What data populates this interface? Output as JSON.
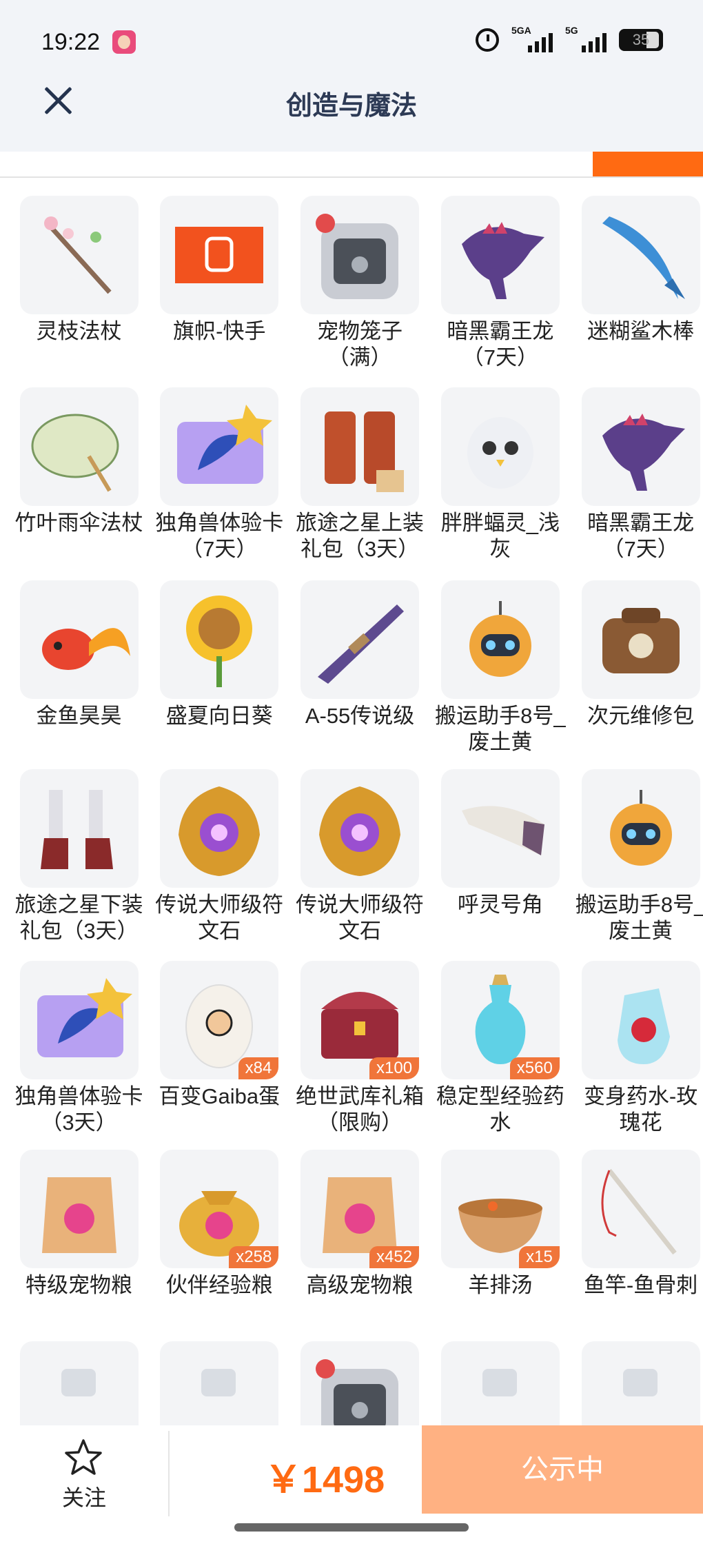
{
  "status_bar": {
    "time": "19:22",
    "signal_1": "5GA",
    "signal_2": "5G",
    "battery": "35"
  },
  "header": {
    "title": "创造与魔法"
  },
  "items": [
    {
      "name": "灵枝法杖",
      "qty": "",
      "icon": "twig-staff-icon"
    },
    {
      "name": "旗帜-快手",
      "qty": "",
      "icon": "kuaishou-flag-icon"
    },
    {
      "name": "宠物笼子（满）",
      "qty": "",
      "icon": "pet-cage-icon"
    },
    {
      "name": "暗黑霸王龙（7天）",
      "qty": "",
      "icon": "dark-trex-icon"
    },
    {
      "name": "迷糊鲨木棒",
      "qty": "",
      "icon": "shark-club-icon"
    },
    {
      "name": "竹叶雨伞法杖",
      "qty": "",
      "icon": "umbrella-staff-icon"
    },
    {
      "name": "独角兽体验卡（7天）",
      "qty": "",
      "icon": "unicorn-card-icon"
    },
    {
      "name": "旅途之星上装礼包（3天）",
      "qty": "",
      "icon": "top-outfit-gift-icon"
    },
    {
      "name": "胖胖蝠灵_浅灰",
      "qty": "",
      "icon": "bat-spirit-icon"
    },
    {
      "name": "暗黑霸王龙（7天）",
      "qty": "",
      "icon": "dark-trex-icon"
    },
    {
      "name": "金鱼昊昊",
      "qty": "",
      "icon": "goldfish-icon"
    },
    {
      "name": "盛夏向日葵",
      "qty": "",
      "icon": "sunflower-icon"
    },
    {
      "name": "A-55传说级",
      "qty": "",
      "icon": "rifle-icon"
    },
    {
      "name": "搬运助手8号_废土黄",
      "qty": "",
      "icon": "helper-robot-icon"
    },
    {
      "name": "次元维修包",
      "qty": "",
      "icon": "repair-bag-icon"
    },
    {
      "name": "旅途之星下装礼包（3天）",
      "qty": "",
      "icon": "boots-gift-icon"
    },
    {
      "name": "传说大师级符文石",
      "qty": "",
      "icon": "rune-stone-icon"
    },
    {
      "name": "传说大师级符文石",
      "qty": "",
      "icon": "rune-stone-icon"
    },
    {
      "name": "呼灵号角",
      "qty": "",
      "icon": "horn-icon"
    },
    {
      "name": "搬运助手8号_废土黄",
      "qty": "",
      "icon": "helper-robot-icon"
    },
    {
      "name": "独角兽体验卡（3天）",
      "qty": "",
      "icon": "unicorn-card-icon"
    },
    {
      "name": "百变Gaiba蛋",
      "qty": "x84",
      "icon": "egg-icon"
    },
    {
      "name": "绝世武库礼箱（限购）",
      "qty": "x100",
      "icon": "treasure-chest-icon"
    },
    {
      "name": "稳定型经验药水",
      "qty": "x560",
      "icon": "potion-icon"
    },
    {
      "name": "变身药水-玫瑰花",
      "qty": "",
      "icon": "rose-potion-icon"
    },
    {
      "name": "特级宠物粮",
      "qty": "",
      "icon": "pet-food-bag-icon"
    },
    {
      "name": "伙伴经验粮",
      "qty": "x258",
      "icon": "exp-food-sack-icon"
    },
    {
      "name": "高级宠物粮",
      "qty": "x452",
      "icon": "pet-food-bag-icon"
    },
    {
      "name": "羊排汤",
      "qty": "x15",
      "icon": "soup-bowl-icon"
    },
    {
      "name": "鱼竿-鱼骨刺",
      "qty": "",
      "icon": "fishing-rod-icon"
    },
    {
      "name": "",
      "qty": "",
      "icon": "partial-item-icon"
    },
    {
      "name": "",
      "qty": "",
      "icon": "partial-item-icon"
    },
    {
      "name": "",
      "qty": "",
      "icon": "pet-cage-icon"
    },
    {
      "name": "",
      "qty": "",
      "icon": "partial-item-icon"
    },
    {
      "name": "",
      "qty": "",
      "icon": "partial-item-icon"
    }
  ],
  "bottom_bar": {
    "follow_label": "关注",
    "price": "￥1498",
    "status_button": "公示中"
  },
  "colors": {
    "accent": "#ff6a12",
    "button_disabled": "#ffb182",
    "qty_badge": "#f0753a",
    "header_bg": "#f2f4f8"
  }
}
